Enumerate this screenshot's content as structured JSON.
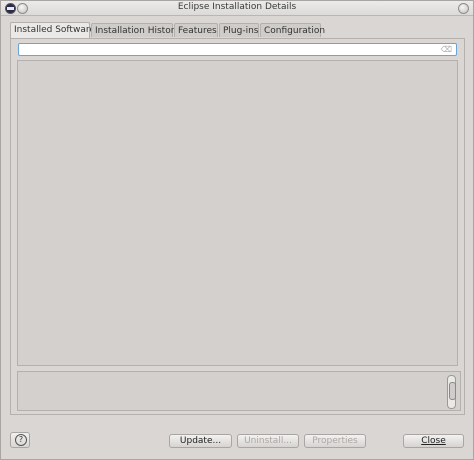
{
  "window": {
    "title": "Eclipse Installation Details"
  },
  "tabs": [
    {
      "label": "Installed Software",
      "active": true
    },
    {
      "label": "Installation History",
      "active": false
    },
    {
      "label": "Features",
      "active": false
    },
    {
      "label": "Plug-ins",
      "active": false
    },
    {
      "label": "Configuration",
      "active": false
    }
  ],
  "search": {
    "value": "",
    "placeholder": ""
  },
  "icons": {
    "app": "eclipse-icon",
    "title_button": "window-control-icon",
    "search_clear": "clear-icon",
    "help": "help-icon"
  },
  "buttons": {
    "help_glyph": "?",
    "update_label": "Update...",
    "uninstall_label": "Uninstall...",
    "properties_label": "Properties",
    "close_label": "Close"
  },
  "colors": {
    "search_focus_border": "#6aa5d6",
    "disabled_text": "#a9a6a3"
  }
}
